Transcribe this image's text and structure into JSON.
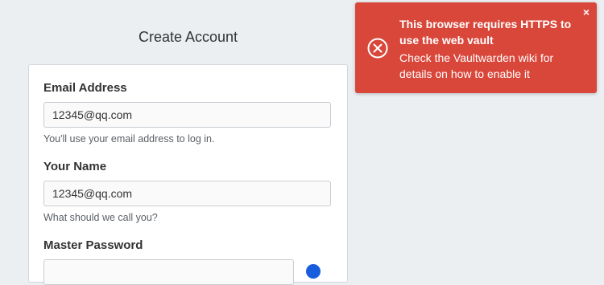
{
  "page": {
    "title": "Create Account"
  },
  "form": {
    "email": {
      "label": "Email Address",
      "value": "12345@qq.com",
      "help": "You'll use your email address to log in."
    },
    "name": {
      "label": "Your Name",
      "value": "12345@qq.com",
      "help": "What should we call you?"
    },
    "master_password": {
      "label": "Master Password",
      "value": ""
    }
  },
  "toast": {
    "title": "This browser requires HTTPS to use the web vault",
    "message": "Check the Vaultwarden wiki for details on how to enable it",
    "close_glyph": "×",
    "icon": "error-circle-x-icon",
    "color": "#d9473b"
  },
  "colors": {
    "background": "#eceff2",
    "card": "#ffffff",
    "info_accent": "#175ddc"
  }
}
